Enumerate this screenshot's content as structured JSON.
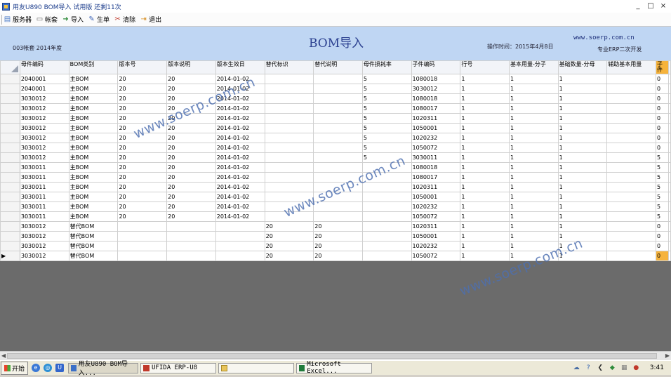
{
  "window": {
    "title": "用友U890 BOM导入 试用版 还剩11次",
    "buttons": [
      "_",
      "□",
      "×"
    ]
  },
  "toolbar": {
    "items": [
      {
        "label": "服务器",
        "icon": "server-icon"
      },
      {
        "label": "帐套",
        "icon": "ledger-icon"
      },
      {
        "label": "导入",
        "icon": "import-icon"
      },
      {
        "label": "生单",
        "icon": "generate-icon"
      },
      {
        "label": "清除",
        "icon": "clear-icon"
      },
      {
        "label": "退出",
        "icon": "exit-icon"
      }
    ]
  },
  "header": {
    "account": "003帐套 2014年度",
    "title": "BOM导入",
    "op_time": "操作时间：2015年4月8日",
    "site": "www.soerp.com.cn",
    "pro": "专业ERP二次开发"
  },
  "grid": {
    "columns": [
      "母件编码",
      "BOM类别",
      "版本号",
      "版本说明",
      "版本生效日",
      "替代标识",
      "替代说明",
      "母件损耗率",
      "子件编码",
      "行号",
      "基本用量-分子",
      "基础数量-分母",
      "辅助基本用量",
      "子件"
    ],
    "rows": [
      [
        "2040001",
        "主BOM",
        "20",
        "20",
        "2014-01-02",
        "",
        "",
        "5",
        "1080018",
        "1",
        "1",
        "1",
        "",
        "0"
      ],
      [
        "2040001",
        "主BOM",
        "20",
        "20",
        "2014-01-02",
        "",
        "",
        "5",
        "3030012",
        "1",
        "1",
        "1",
        "",
        "0"
      ],
      [
        "3030012",
        "主BOM",
        "20",
        "20",
        "2014-01-02",
        "",
        "",
        "5",
        "1080018",
        "1",
        "1",
        "1",
        "",
        "0"
      ],
      [
        "3030012",
        "主BOM",
        "20",
        "20",
        "2014-01-02",
        "",
        "",
        "5",
        "1080017",
        "1",
        "1",
        "1",
        "",
        "0"
      ],
      [
        "3030012",
        "主BOM",
        "20",
        "20",
        "2014-01-02",
        "",
        "",
        "5",
        "1020311",
        "1",
        "1",
        "1",
        "",
        "0"
      ],
      [
        "3030012",
        "主BOM",
        "20",
        "20",
        "2014-01-02",
        "",
        "",
        "5",
        "1050001",
        "1",
        "1",
        "1",
        "",
        "0"
      ],
      [
        "3030012",
        "主BOM",
        "20",
        "20",
        "2014-01-02",
        "",
        "",
        "5",
        "1020232",
        "1",
        "1",
        "1",
        "",
        "0"
      ],
      [
        "3030012",
        "主BOM",
        "20",
        "20",
        "2014-01-02",
        "",
        "",
        "5",
        "1050072",
        "1",
        "1",
        "1",
        "",
        "0"
      ],
      [
        "3030012",
        "主BOM",
        "20",
        "20",
        "2014-01-02",
        "",
        "",
        "5",
        "3030011",
        "1",
        "1",
        "1",
        "",
        "5"
      ],
      [
        "3030011",
        "主BOM",
        "20",
        "20",
        "2014-01-02",
        "",
        "",
        "",
        "1080018",
        "1",
        "1",
        "1",
        "",
        "5"
      ],
      [
        "3030011",
        "主BOM",
        "20",
        "20",
        "2014-01-02",
        "",
        "",
        "",
        "1080017",
        "1",
        "1",
        "1",
        "",
        "5"
      ],
      [
        "3030011",
        "主BOM",
        "20",
        "20",
        "2014-01-02",
        "",
        "",
        "",
        "1020311",
        "1",
        "1",
        "1",
        "",
        "5"
      ],
      [
        "3030011",
        "主BOM",
        "20",
        "20",
        "2014-01-02",
        "",
        "",
        "",
        "1050001",
        "1",
        "1",
        "1",
        "",
        "5"
      ],
      [
        "3030011",
        "主BOM",
        "20",
        "20",
        "2014-01-02",
        "",
        "",
        "",
        "1020232",
        "1",
        "1",
        "1",
        "",
        "5"
      ],
      [
        "3030011",
        "主BOM",
        "20",
        "20",
        "2014-01-02",
        "",
        "",
        "",
        "1050072",
        "1",
        "1",
        "1",
        "",
        "5"
      ],
      [
        "3030012",
        "替代BOM",
        "",
        "",
        "",
        "20",
        "20",
        "",
        "1020311",
        "1",
        "1",
        "1",
        "",
        "0"
      ],
      [
        "3030012",
        "替代BOM",
        "",
        "",
        "",
        "20",
        "20",
        "",
        "1050001",
        "1",
        "1",
        "1",
        "",
        "0"
      ],
      [
        "3030012",
        "替代BOM",
        "",
        "",
        "",
        "20",
        "20",
        "",
        "1020232",
        "1",
        "1",
        "1",
        "",
        "0"
      ],
      [
        "3030012",
        "替代BOM",
        "",
        "",
        "",
        "20",
        "20",
        "",
        "1050072",
        "1",
        "1",
        "1",
        "",
        "0"
      ]
    ],
    "current_row": 18,
    "current_row_marker": "▶"
  },
  "watermark": "www.soerp.com.cn",
  "taskbar": {
    "start": "开始",
    "tasks": [
      {
        "label": "用友U890 BOM导入...",
        "icon": "app-icon",
        "active": true
      },
      {
        "label": "UFIDA ERP-U8",
        "icon": "ufida-icon",
        "active": false
      },
      {
        "label": "",
        "icon": "folder-icon",
        "active": false
      },
      {
        "label": "Microsoft Excel...",
        "icon": "excel-icon",
        "active": false
      }
    ],
    "clock": "3:41"
  },
  "colors": {
    "header_bg": "#bfd6f3",
    "highlight": "#f6b33c",
    "grid_empty": "#6b6b6b"
  }
}
